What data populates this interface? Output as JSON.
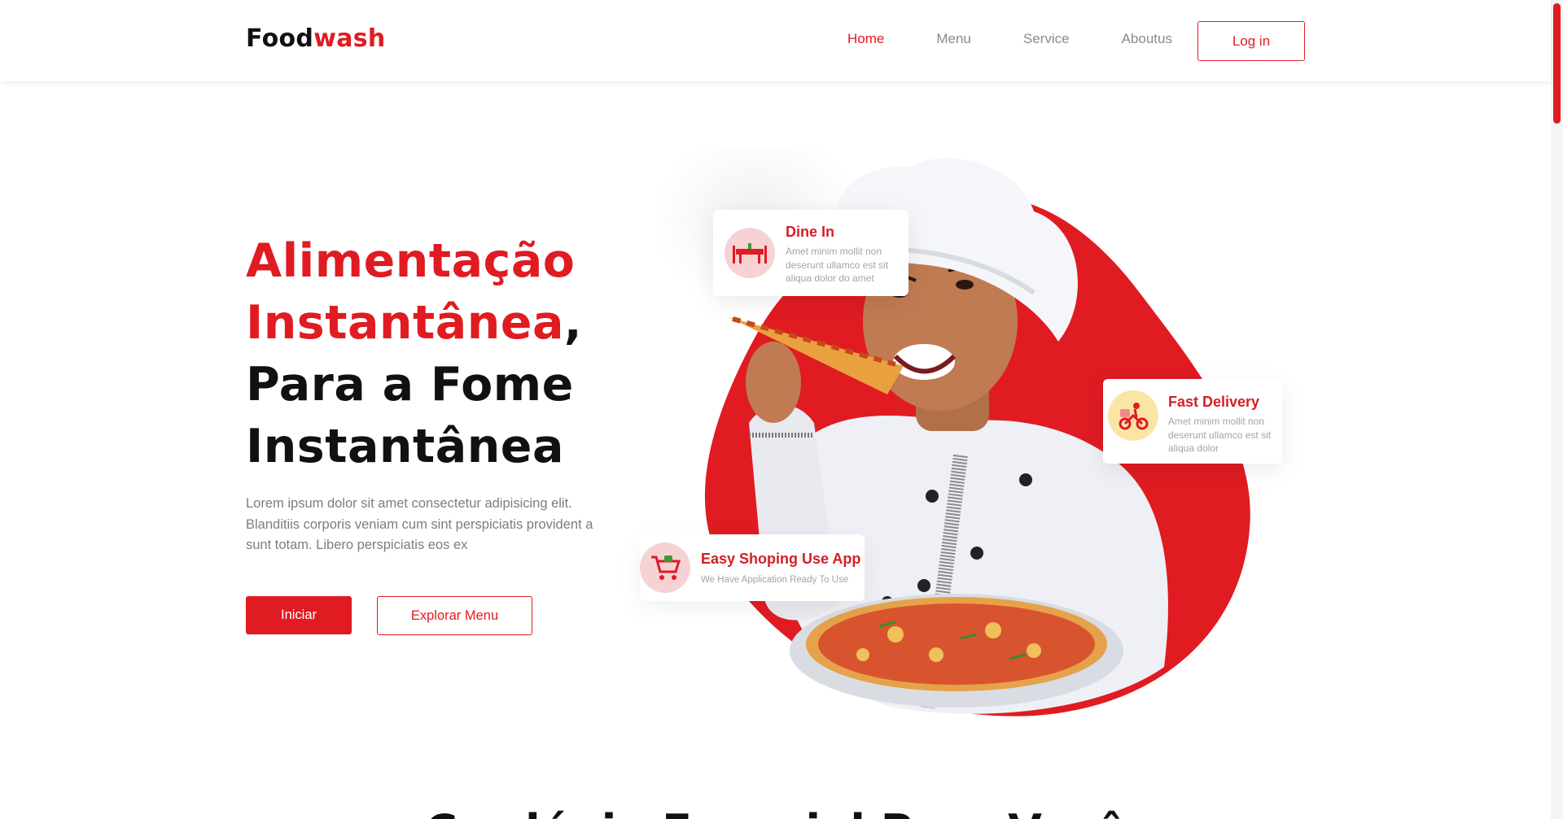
{
  "brand": {
    "part1": "Food",
    "part2": "wash"
  },
  "nav": {
    "items": [
      {
        "label": "Home",
        "active": true
      },
      {
        "label": "Menu",
        "active": false
      },
      {
        "label": "Service",
        "active": false
      },
      {
        "label": "Aboutus",
        "active": false
      }
    ],
    "login_label": "Log in"
  },
  "hero": {
    "headline_red_1": "Alimentação",
    "headline_red_2": "Instantânea",
    "headline_comma": ",",
    "headline_line3": "Para a Fome",
    "headline_line4": "Instantânea",
    "description": "Lorem ipsum dolor sit amet consectetur adipisicing elit. Blanditiis corporis veniam cum sint perspiciatis provident a sunt totam. Libero perspiciatis eos ex",
    "primary_button": "Iniciar",
    "secondary_button": "Explorar Menu"
  },
  "cards": {
    "dine_in": {
      "title": "Dine In",
      "text": "Amet minim mollit non deserunt ullamco est sit aliqua dolor do amet",
      "icon": "dining-table-icon"
    },
    "fast_delivery": {
      "title": "Fast Delivery",
      "text": "Amet minim mollit non deserunt ullamco est sit aliqua dolor",
      "icon": "delivery-scooter-icon"
    },
    "easy_shopping": {
      "title": "Easy Shoping Use App",
      "text": "We Have Application Ready To Use",
      "icon": "shopping-cart-icon"
    }
  },
  "section_title": "Cardápio Especial Para Você",
  "colors": {
    "accent": "#e01b22",
    "text": "#111111",
    "muted": "#7d7d7d"
  }
}
